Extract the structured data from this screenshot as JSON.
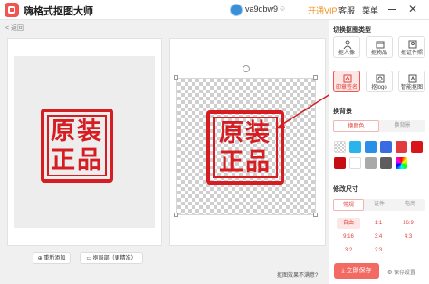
{
  "titlebar": {
    "app_title": "嗨格式抠图大师",
    "username": "va9dbw9",
    "user_badge": "☺",
    "vip_label": "开通VIP",
    "service_label": "客服",
    "menu_label": "菜单",
    "minimize_icon": "minimize-icon",
    "close_icon": "close-icon",
    "close_glyph": "✕"
  },
  "nav": {
    "back_label": "< 返回"
  },
  "canvas": {
    "stamp_line1": "原装",
    "stamp_line2": "正品",
    "reupload_label": "重新添加",
    "refine_label": "抠局部（更精准）",
    "feedback_label": "抠图效果不满意?"
  },
  "sidebar": {
    "switch_type_title": "切换抠图类型",
    "types": [
      {
        "label": "抠人像",
        "icon": "person-icon"
      },
      {
        "label": "抠物品",
        "icon": "box-icon"
      },
      {
        "label": "抠证件照",
        "icon": "id-photo-icon"
      },
      {
        "label": "印章签名",
        "icon": "stamp-icon",
        "active": true
      },
      {
        "label": "抠logo",
        "icon": "logo-icon"
      },
      {
        "label": "智能抠图",
        "icon": "smart-cutout-icon"
      }
    ],
    "background_title": "换背景",
    "bg_tabs": {
      "color": "换颜色",
      "image": "换背景"
    },
    "swatch_colors": [
      "transparent",
      "#29b4ec",
      "#2a8fe8",
      "#3a6be3",
      "#e33b3b",
      "#d8151b",
      "#c80d12",
      "#ffffff",
      "#a9a9a9",
      "#5d5d5d",
      "rainbow"
    ],
    "size_title": "修改尺寸",
    "size_tabs": {
      "common": "常规",
      "id": "证件",
      "ecommerce": "电商"
    },
    "ratios": [
      "自由",
      "1:1",
      "16:9",
      "9:16",
      "3:4",
      "4:3",
      "3:2",
      "2:3"
    ],
    "save_label": "立即保存",
    "save_settings_label": "保存设置"
  },
  "colors": {
    "accent": "#f0554f",
    "stamp_red": "#d51d22",
    "vip": "#f08f1a"
  }
}
